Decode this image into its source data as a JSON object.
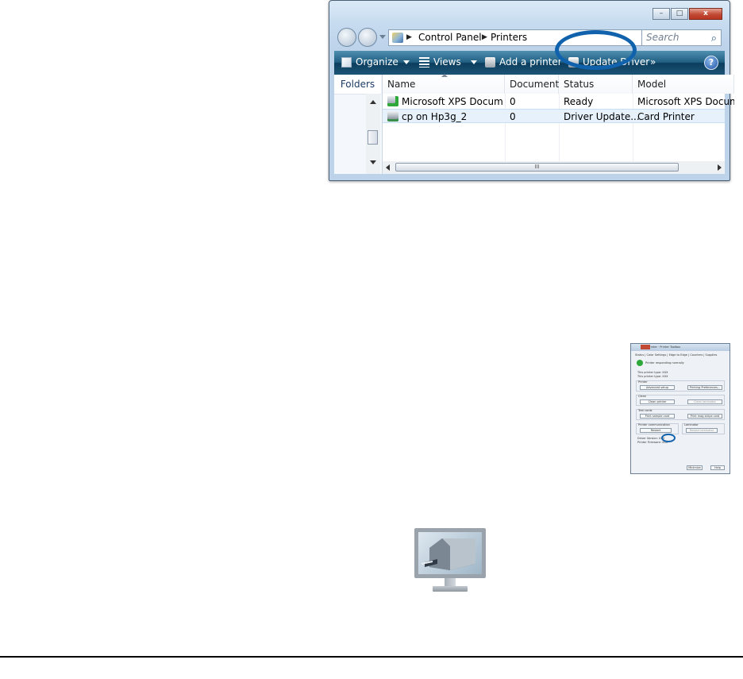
{
  "window": {
    "caption_buttons": {
      "minimize": "–",
      "maximize": "□",
      "close": "x"
    },
    "address": {
      "crumbs": [
        "Control Panel",
        "Printers"
      ]
    },
    "search_placeholder": "Search",
    "command_bar": {
      "organize": "Organize",
      "views": "Views",
      "add_printer": "Add a printer",
      "update_driver": "Update Driver",
      "more": "»",
      "help": "?"
    },
    "folders_label": "Folders",
    "columns": [
      "Name",
      "Documents",
      "Status",
      "Model"
    ],
    "rows": [
      {
        "name": "Microsoft XPS Docum...",
        "documents": "0",
        "status": "Ready",
        "model": "Microsoft XPS Docum",
        "selected": false
      },
      {
        "name": "cp on Hp3g_2",
        "documents": "0",
        "status": "Driver Update...",
        "model": "Card Printer",
        "selected": true
      }
    ],
    "hscroll_grip": "III",
    "accent_color": "#1162ad"
  },
  "toolbox": {
    "title": "Card Printer · Printer Toolbox",
    "tabs": "Status | Color Settings | Edge to Edge | Counters | Supplies",
    "status": "Printer responding normally",
    "printer_type_1": "This printer type: XXX",
    "printer_type_2": "This printer type: XXX",
    "groups": {
      "printer": "Printer",
      "clean": "Clean",
      "test": "Test cards",
      "comm": "Printer communication",
      "laminator": "Laminator"
    },
    "buttons": {
      "advanced": "Advanced setup",
      "preferences": "Printing Preferences...",
      "clean_printer": "Clean printer",
      "clean_laminator": "Clean laminator",
      "print_sample": "Print sample card",
      "print_mag": "Print mag stripe card",
      "restart": "Restart",
      "restart_lam": "Restart laminator",
      "minimize": "Minimize",
      "help": "Help"
    },
    "driver_version": "Driver Version: XXX",
    "printer_firmware": "Printer Firmware: XXX"
  }
}
